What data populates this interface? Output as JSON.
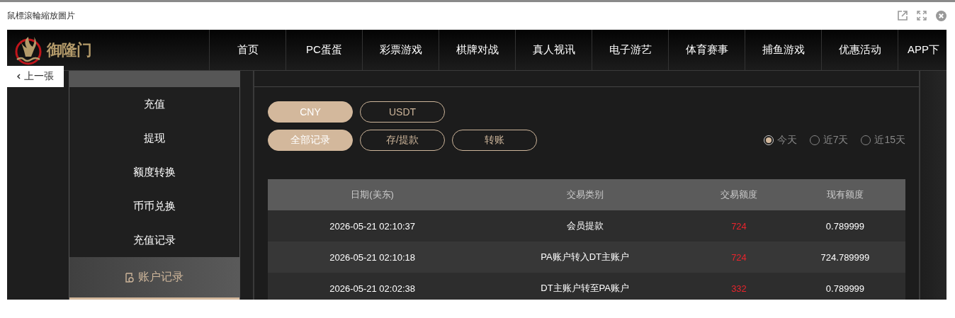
{
  "window": {
    "title": "鼠標滾輪縮放圖片"
  },
  "header": {
    "logo": "御隆门",
    "nav": [
      {
        "label": "首页"
      },
      {
        "label": "PC蛋蛋"
      },
      {
        "label": "彩票游戏"
      },
      {
        "label": "棋牌对战"
      },
      {
        "label": "真人视讯"
      },
      {
        "label": "电子游艺"
      },
      {
        "label": "体育赛事"
      },
      {
        "label": "捕鱼游戏"
      },
      {
        "label": "优惠活动"
      },
      {
        "label": "APP下"
      }
    ]
  },
  "prev_button": {
    "label": "上一張"
  },
  "sidebar": {
    "items": [
      {
        "label": "充值",
        "selected": false
      },
      {
        "label": "提现",
        "selected": false
      },
      {
        "label": "额度转换",
        "selected": false
      },
      {
        "label": "币币兑换",
        "selected": false
      },
      {
        "label": "充值记录",
        "selected": false
      },
      {
        "label": "账户记录",
        "selected": true
      }
    ]
  },
  "currency_tabs": [
    {
      "label": "CNY",
      "selected": true
    },
    {
      "label": "USDT",
      "selected": false
    }
  ],
  "type_tabs": [
    {
      "label": "全部记录",
      "selected": true
    },
    {
      "label": "存/提款",
      "selected": false
    },
    {
      "label": "转账",
      "selected": false
    }
  ],
  "date_range": [
    {
      "label": "今天",
      "selected": true
    },
    {
      "label": "近7天",
      "selected": false
    },
    {
      "label": "近15天",
      "selected": false
    }
  ],
  "table": {
    "columns": [
      "日期(美东)",
      "交易类别",
      "交易额度",
      "现有额度"
    ],
    "rows": [
      {
        "cells": [
          "2026-05-21 02:10:37",
          "会员提款",
          "724",
          "0.789999"
        ]
      },
      {
        "cells": [
          "2026-05-21 02:10:18",
          "PA账户转入DT主账户",
          "724",
          "724.789999"
        ]
      },
      {
        "cells": [
          "2026-05-21 02:02:38",
          "DT主账户转至PA账户",
          "332",
          "0.789999"
        ]
      }
    ]
  }
}
